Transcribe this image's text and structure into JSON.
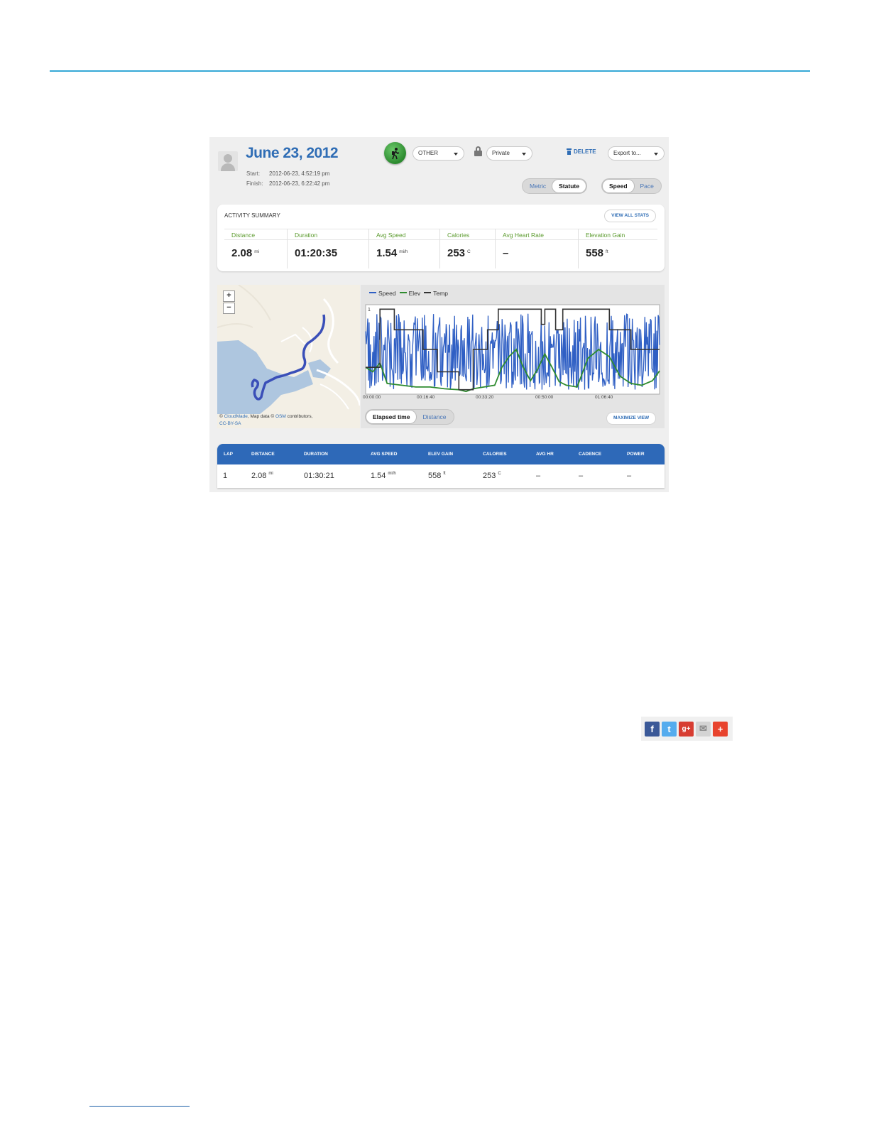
{
  "activity": {
    "title": "June 23, 2012",
    "start_label": "Start:",
    "start_value": "2012-06-23, 4:52:19 pm",
    "finish_label": "Finish:",
    "finish_value": "2012-06-23, 6:22:42 pm",
    "sport_dropdown": "OTHER",
    "privacy_dropdown": "Private",
    "delete_label": "DELETE",
    "export_dropdown": "Export to...",
    "unit_toggle": [
      "Metric",
      "Statute"
    ],
    "unit_selected": "Statute",
    "display_toggle": [
      "Speed",
      "Pace"
    ],
    "display_selected": "Speed"
  },
  "summary": {
    "title": "ACTIVITY SUMMARY",
    "view_all_label": "VIEW ALL STATS",
    "stats": [
      {
        "label": "Distance",
        "value": "2.08",
        "unit": "mi"
      },
      {
        "label": "Duration",
        "value": "01:20:35",
        "unit": ""
      },
      {
        "label": "Avg Speed",
        "value": "1.54",
        "unit": "mi/h"
      },
      {
        "label": "Calories",
        "value": "253",
        "unit": "C"
      },
      {
        "label": "Avg Heart Rate",
        "value": "–",
        "unit": ""
      },
      {
        "label": "Elevation Gain",
        "value": "558",
        "unit": "ft"
      }
    ]
  },
  "map": {
    "zoom_in": "+",
    "zoom_out": "−",
    "credit_prefix": "© ",
    "credit_link1": "CloudMade",
    "credit_mid": ", Map data © ",
    "credit_link2": "OSM",
    "credit_suffix": " contributors,",
    "credit_license": "CC-BY-SA"
  },
  "chart": {
    "legend": [
      {
        "name": "Speed",
        "color": "#2f5fc4"
      },
      {
        "name": "Elev",
        "color": "#2e8b2e"
      },
      {
        "name": "Temp",
        "color": "#333333"
      }
    ],
    "axis_toggle": [
      "Elapsed time",
      "Distance"
    ],
    "axis_selected": "Elapsed time",
    "maximize_label": "MAXIMIZE VIEW"
  },
  "chart_data": {
    "type": "line",
    "x_label": "Elapsed time",
    "x_ticks": [
      "00:00:00",
      "00:16:40",
      "00:33:20",
      "00:50:00",
      "01:06:40"
    ],
    "y_top_label": "1",
    "x_range_minutes": [
      0,
      82
    ],
    "series": [
      {
        "name": "Temp",
        "color": "#333333",
        "step_points": [
          [
            0,
            0.3
          ],
          [
            4,
            0.3
          ],
          [
            4,
            0.95
          ],
          [
            8,
            0.95
          ],
          [
            8,
            0.72
          ],
          [
            16,
            0.72
          ],
          [
            16,
            0.5
          ],
          [
            20,
            0.5
          ],
          [
            20,
            0.25
          ],
          [
            26,
            0.25
          ],
          [
            26,
            0.05
          ],
          [
            30,
            0.05
          ],
          [
            30,
            0.5
          ],
          [
            34,
            0.5
          ],
          [
            34,
            0.72
          ],
          [
            37,
            0.72
          ],
          [
            37,
            0.95
          ],
          [
            49,
            0.95
          ],
          [
            49,
            0.78
          ],
          [
            50,
            0.78
          ],
          [
            50,
            0.95
          ],
          [
            53,
            0.95
          ],
          [
            53,
            0.72
          ],
          [
            55,
            0.72
          ],
          [
            55,
            0.95
          ],
          [
            68,
            0.95
          ],
          [
            68,
            0.72
          ],
          [
            74,
            0.72
          ],
          [
            74,
            0.5
          ],
          [
            82,
            0.5
          ]
        ]
      },
      {
        "name": "Elev",
        "color": "#2e8b2e",
        "points": [
          [
            0,
            0.3
          ],
          [
            2,
            0.25
          ],
          [
            4,
            0.35
          ],
          [
            6,
            0.12
          ],
          [
            10,
            0.1
          ],
          [
            14,
            0.08
          ],
          [
            18,
            0.08
          ],
          [
            22,
            0.06
          ],
          [
            26,
            0.05
          ],
          [
            28,
            0.03
          ],
          [
            30,
            0.06
          ],
          [
            33,
            0.08
          ],
          [
            36,
            0.1
          ],
          [
            38,
            0.3
          ],
          [
            40,
            0.42
          ],
          [
            42,
            0.5
          ],
          [
            44,
            0.3
          ],
          [
            46,
            0.15
          ],
          [
            48,
            0.28
          ],
          [
            50,
            0.45
          ],
          [
            52,
            0.3
          ],
          [
            54,
            0.14
          ],
          [
            56,
            0.1
          ],
          [
            59,
            0.08
          ],
          [
            62,
            0.4
          ],
          [
            65,
            0.5
          ],
          [
            68,
            0.42
          ],
          [
            71,
            0.2
          ],
          [
            74,
            0.12
          ],
          [
            77,
            0.1
          ],
          [
            80,
            0.15
          ],
          [
            82,
            0.26
          ]
        ]
      },
      {
        "name": "Speed",
        "color": "#2f5fc4",
        "description_values": "rapid fluctuation between approximately 0.05 and 0.9 across the full duration"
      }
    ]
  },
  "laps": {
    "headers": [
      "LAP",
      "DISTANCE",
      "DURATION",
      "AVG SPEED",
      "ELEV GAIN",
      "CALORIES",
      "AVG HR",
      "CADENCE",
      "POWER"
    ],
    "rows": [
      {
        "lap": "1",
        "distance": "2.08",
        "distance_unit": "mi",
        "duration": "01:30:21",
        "avg_speed": "1.54",
        "avg_speed_unit": "mi/h",
        "elev_gain": "558",
        "elev_unit": "ft",
        "calories": "253",
        "calories_unit": "C",
        "avg_hr": "–",
        "cadence": "–",
        "power": "–"
      }
    ]
  },
  "share": {
    "icons": [
      {
        "name": "facebook-icon",
        "glyph": "f",
        "color": "#3b5998"
      },
      {
        "name": "twitter-icon",
        "glyph": "t",
        "color": "#55acee"
      },
      {
        "name": "google-plus-icon",
        "glyph": "g+",
        "color": "#d73d32"
      },
      {
        "name": "email-icon",
        "glyph": "✉",
        "color": "#bdbdbd"
      },
      {
        "name": "addthis-icon",
        "glyph": "+",
        "color": "#e8432d"
      }
    ]
  }
}
